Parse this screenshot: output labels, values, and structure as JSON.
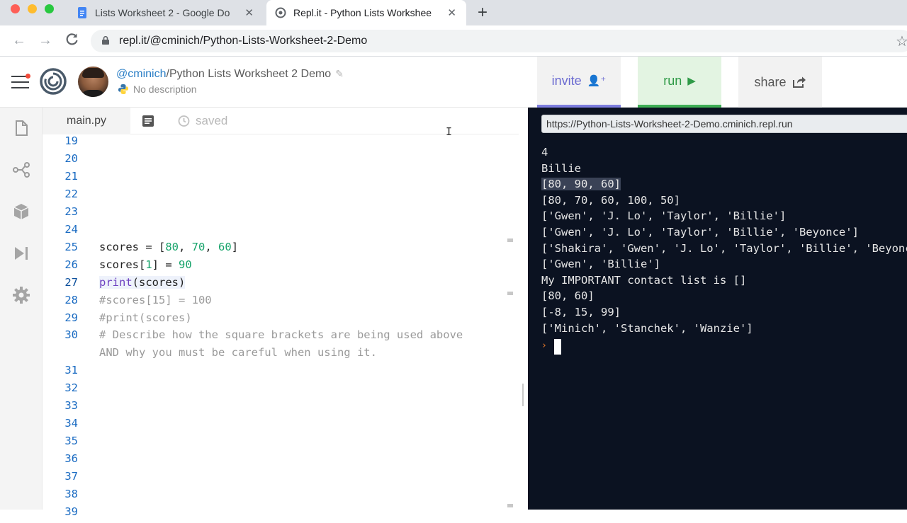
{
  "browser": {
    "tabs": [
      {
        "title": "Lists Worksheet 2 - Google Do",
        "close": "✕",
        "active": false
      },
      {
        "title": "Repl.it - Python Lists Workshee",
        "close": "✕",
        "active": true
      }
    ],
    "new_tab": "+",
    "url": "repl.it/@cminich/Python-Lists-Worksheet-2-Demo"
  },
  "header": {
    "username": "@cminich",
    "separator": "/",
    "repl_name": "Python Lists Worksheet 2 Demo",
    "description": "No description",
    "invite_label": "invite",
    "run_label": "run",
    "share_label": "share"
  },
  "editor": {
    "file_tab": "main.py",
    "status": "saved",
    "lines": [
      {
        "n": "19",
        "code": ""
      },
      {
        "n": "20",
        "code": ""
      },
      {
        "n": "21",
        "code": ""
      },
      {
        "n": "22",
        "code": ""
      },
      {
        "n": "23",
        "code": ""
      },
      {
        "n": "24",
        "code": ""
      },
      {
        "n": "25",
        "code": "scores = [80, 70, 60]"
      },
      {
        "n": "26",
        "code": "scores[1] = 90"
      },
      {
        "n": "27",
        "code": "print(scores)"
      },
      {
        "n": "28",
        "code": "#scores[15] = 100"
      },
      {
        "n": "29",
        "code": "#print(scores)"
      },
      {
        "n": "30",
        "code": "# Describe how the square brackets are being used above"
      },
      {
        "n": "",
        "code": "AND why you must be careful when using it."
      },
      {
        "n": "31",
        "code": ""
      },
      {
        "n": "32",
        "code": ""
      },
      {
        "n": "33",
        "code": ""
      },
      {
        "n": "34",
        "code": ""
      },
      {
        "n": "35",
        "code": ""
      },
      {
        "n": "36",
        "code": ""
      },
      {
        "n": "37",
        "code": ""
      },
      {
        "n": "38",
        "code": ""
      },
      {
        "n": "39",
        "code": ""
      }
    ]
  },
  "console": {
    "url": "https://Python-Lists-Worksheet-2-Demo.cminich.repl.run",
    "output": [
      "4",
      "Billie",
      "[80, 90, 60]",
      "[80, 70, 60, 100, 50]",
      "['Gwen', 'J. Lo', 'Taylor', 'Billie']",
      "['Gwen', 'J. Lo', 'Taylor', 'Billie', 'Beyonce']",
      "['Shakira', 'Gwen', 'J. Lo', 'Taylor', 'Billie', 'Beyonce']",
      "['Gwen', 'Billie']",
      "My IMPORTANT contact list is []",
      "[80, 60]",
      "[-8, 15, 99]",
      "['Minich', 'Stanchek', 'Wanzie']"
    ],
    "prompt": "›"
  },
  "colors": {
    "accent_invite": "#6b6bd1",
    "accent_run": "#2f9a47",
    "console_bg": "#0b1221",
    "line_number": "#1a6bc2"
  },
  "icons": {
    "rail": [
      "files-icon",
      "version-control-icon",
      "packages-icon",
      "debugger-icon",
      "settings-icon"
    ]
  }
}
